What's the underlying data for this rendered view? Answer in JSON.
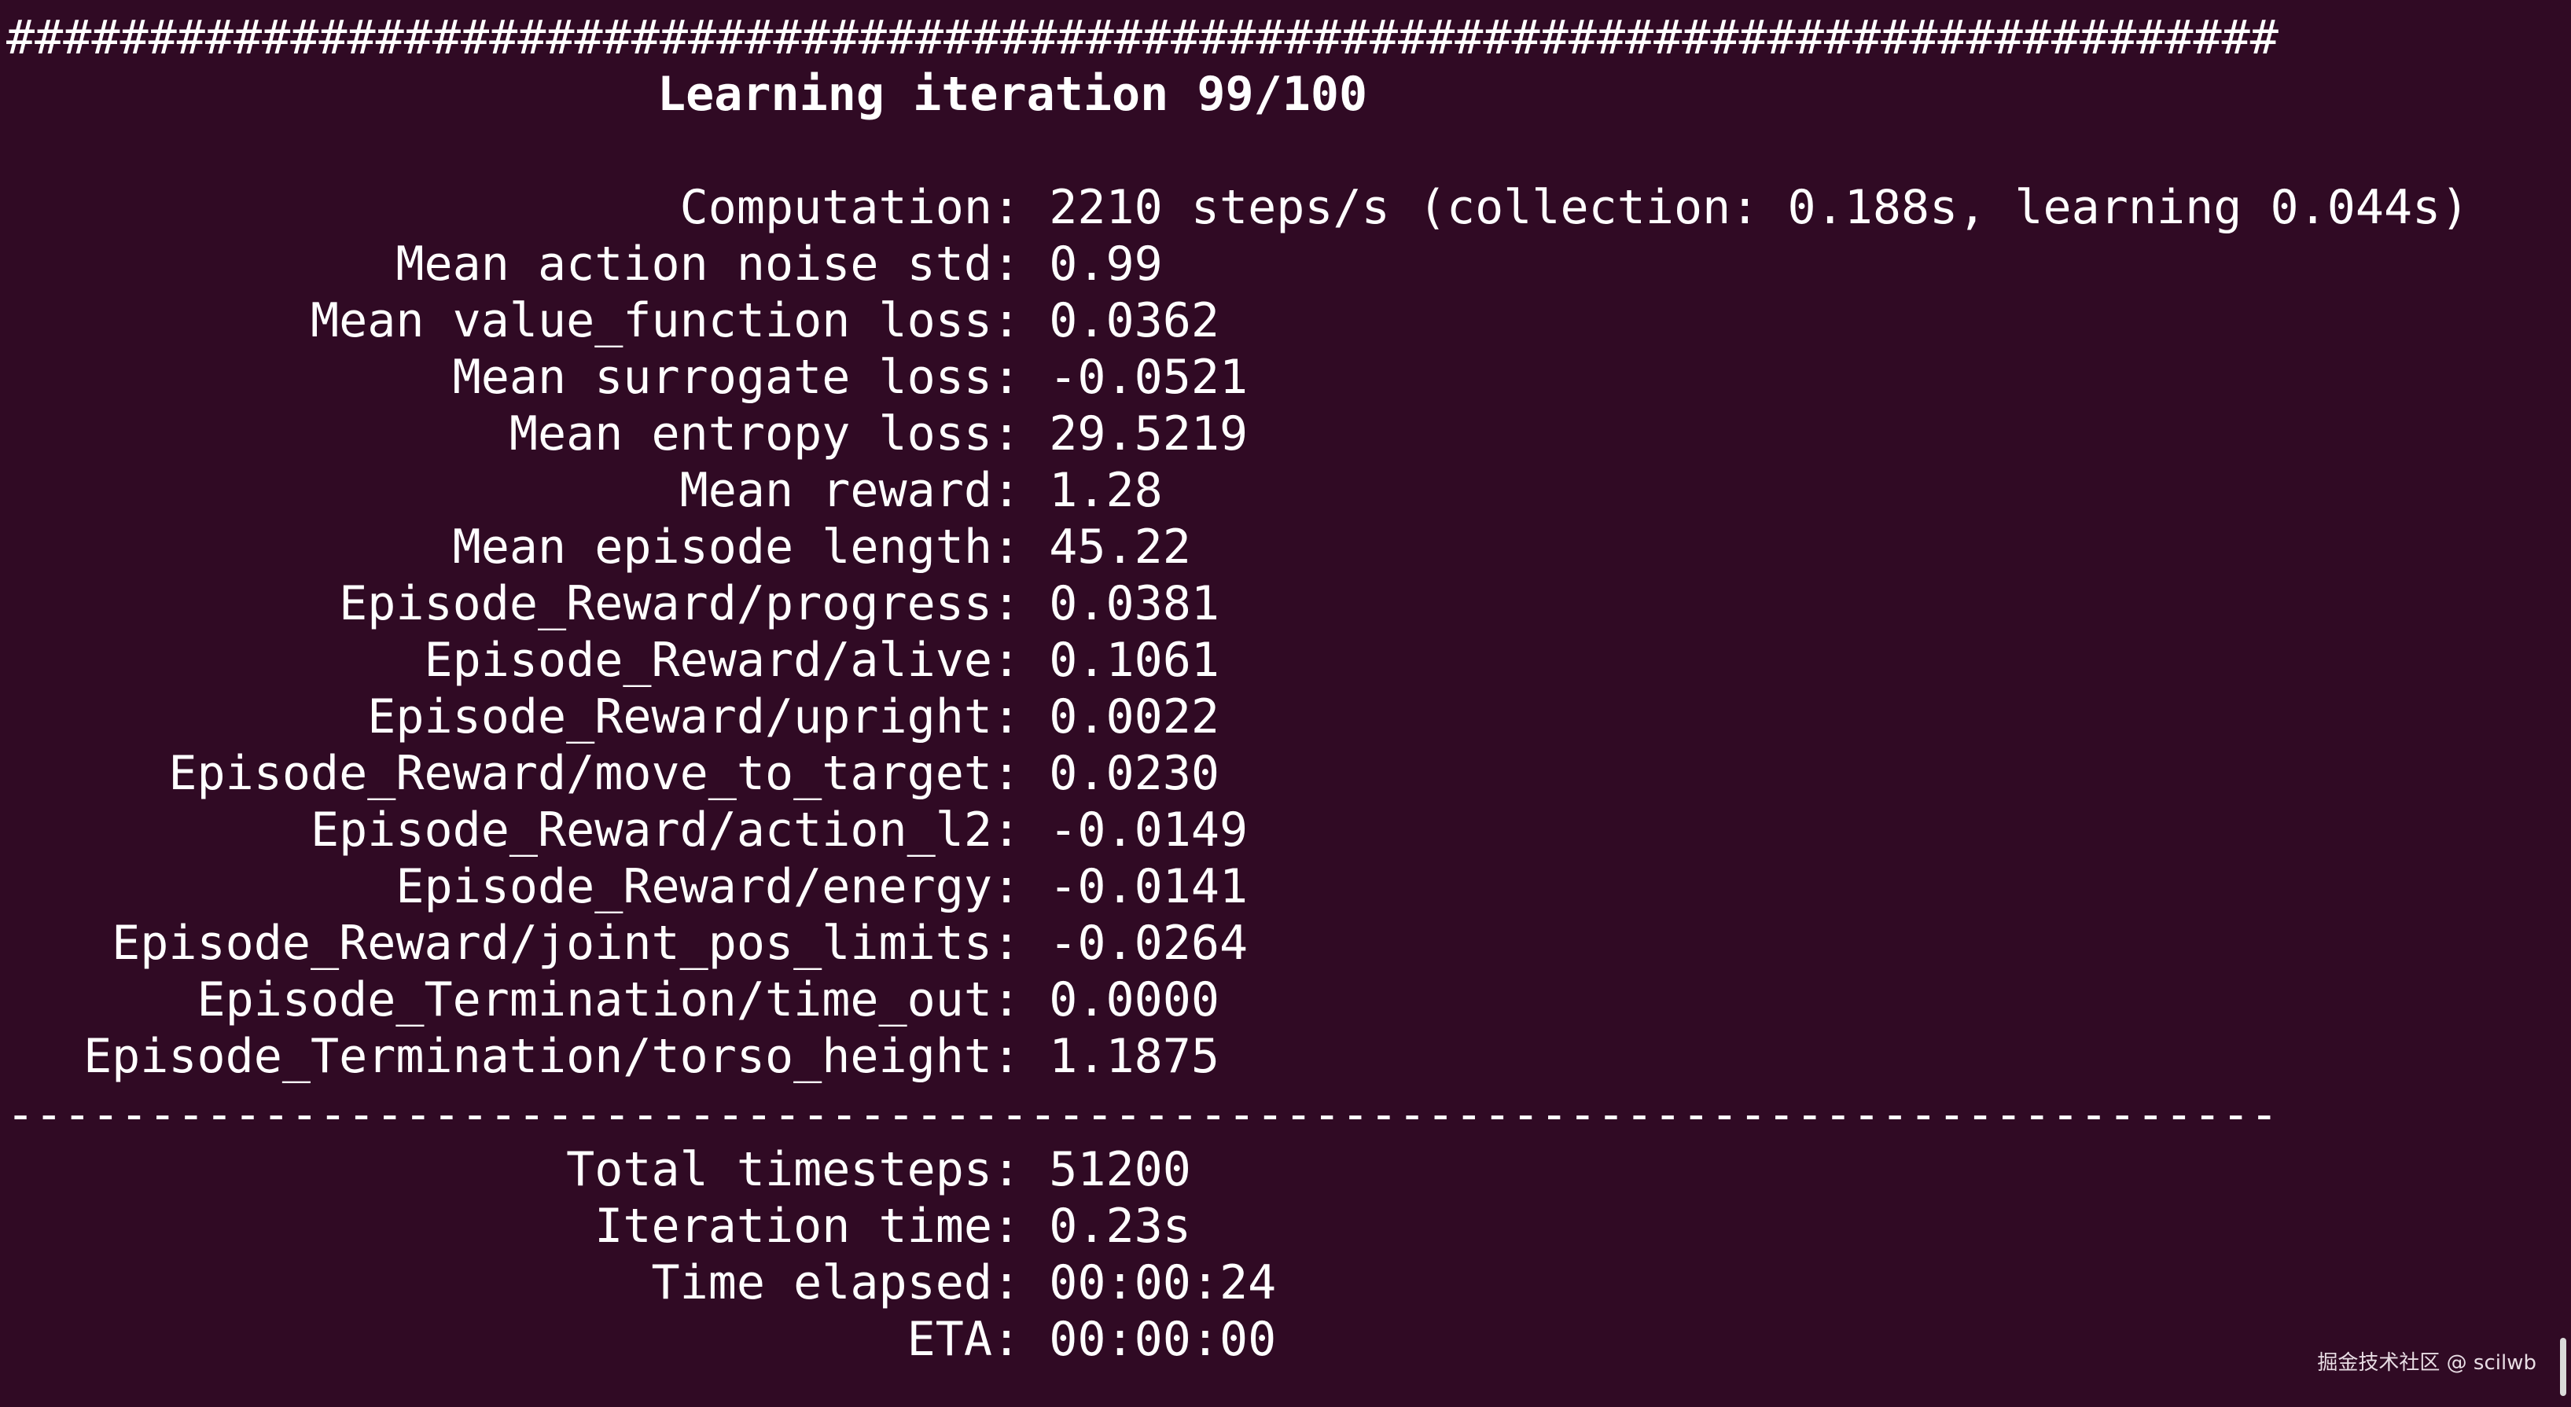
{
  "header": {
    "hash_rule": "################################################################################",
    "title": "Learning iteration 99/100"
  },
  "metrics": [
    {
      "label": "Computation",
      "value": "2210 steps/s (collection: 0.188s, learning 0.044s)"
    },
    {
      "label": "Mean action noise std",
      "value": "0.99"
    },
    {
      "label": "Mean value_function loss",
      "value": "0.0362"
    },
    {
      "label": "Mean surrogate loss",
      "value": "-0.0521"
    },
    {
      "label": "Mean entropy loss",
      "value": "29.5219"
    },
    {
      "label": "Mean reward",
      "value": "1.28"
    },
    {
      "label": "Mean episode length",
      "value": "45.22"
    },
    {
      "label": "Episode_Reward/progress",
      "value": "0.0381"
    },
    {
      "label": "Episode_Reward/alive",
      "value": "0.1061"
    },
    {
      "label": "Episode_Reward/upright",
      "value": "0.0022"
    },
    {
      "label": "Episode_Reward/move_to_target",
      "value": "0.0230"
    },
    {
      "label": "Episode_Reward/action_l2",
      "value": "-0.0149"
    },
    {
      "label": "Episode_Reward/energy",
      "value": "-0.0141"
    },
    {
      "label": "Episode_Reward/joint_pos_limits",
      "value": "-0.0264"
    },
    {
      "label": "Episode_Termination/time_out",
      "value": "0.0000"
    },
    {
      "label": "Episode_Termination/torso_height",
      "value": "1.1875"
    }
  ],
  "dash_rule": "--------------------------------------------------------------------------------",
  "summary": [
    {
      "label": "Total timesteps",
      "value": "51200"
    },
    {
      "label": "Iteration time",
      "value": "0.23s"
    },
    {
      "label": "Time elapsed",
      "value": "00:00:24"
    },
    {
      "label": "ETA",
      "value": "00:00:00"
    }
  ],
  "separator": ": ",
  "watermark": "掘金技术社区 @ scilwb"
}
